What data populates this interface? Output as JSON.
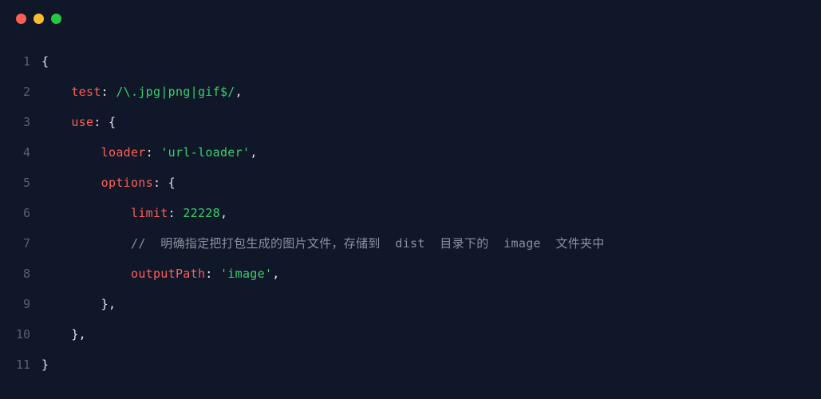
{
  "window": {
    "traffic_lights": [
      "red",
      "yellow",
      "green"
    ]
  },
  "code": {
    "line_numbers": [
      "1",
      "2",
      "3",
      "4",
      "5",
      "6",
      "7",
      "8",
      "9",
      "10",
      "11"
    ],
    "indent": {
      "l0": "",
      "l1": "    ",
      "l2": "        ",
      "l3": "            "
    },
    "punct": {
      "open_brace": "{",
      "close_brace": "}",
      "colon_sp": ": ",
      "comma": ",",
      "close_brace_comma": "},"
    },
    "keys": {
      "test": "test",
      "use": "use",
      "loader": "loader",
      "options": "options",
      "limit": "limit",
      "outputPath": "outputPath"
    },
    "values": {
      "regex": "/\\.jpg|png|gif$/",
      "loader_str": "'url-loader'",
      "limit_num": "22228",
      "comment": "//  明确指定把打包生成的图片文件，存储到  dist  目录下的  image  文件夹中",
      "outputPath_str": "'image'"
    }
  }
}
